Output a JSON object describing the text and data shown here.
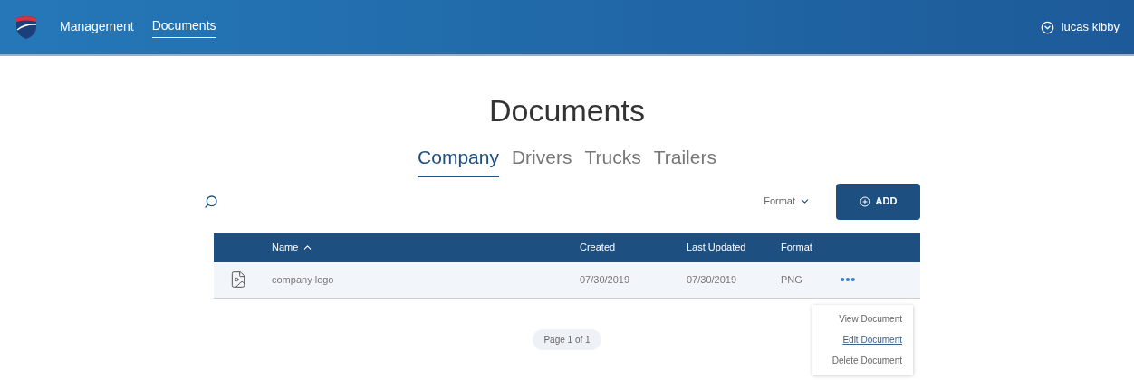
{
  "nav": {
    "items": [
      {
        "label": "Management",
        "selected": false
      },
      {
        "label": "Documents",
        "selected": true
      }
    ],
    "user": "lucas kibby"
  },
  "title": "Documents",
  "tabs": [
    {
      "label": "Company",
      "selected": true
    },
    {
      "label": "Drivers",
      "selected": false
    },
    {
      "label": "Trucks",
      "selected": false
    },
    {
      "label": "Trailers",
      "selected": false
    }
  ],
  "toolbar": {
    "filter": "Format",
    "add_button": "ADD"
  },
  "table": {
    "columns": [
      {
        "label": "Name",
        "sorted": true
      },
      {
        "label": "Created",
        "sorted": false
      },
      {
        "label": "Last Updated",
        "sorted": false
      },
      {
        "label": "Format",
        "sorted": false
      }
    ],
    "rows": [
      {
        "name": "company logo",
        "created": "07/30/2019",
        "last_updated": "07/30/2019",
        "format": "PNG"
      }
    ]
  },
  "row_menu": {
    "items": [
      {
        "label": "View Document",
        "hovered": false
      },
      {
        "label": "Edit Document",
        "hovered": true
      },
      {
        "label": "Delete Document",
        "hovered": false
      }
    ]
  },
  "pagination": "Page 1 of 1"
}
